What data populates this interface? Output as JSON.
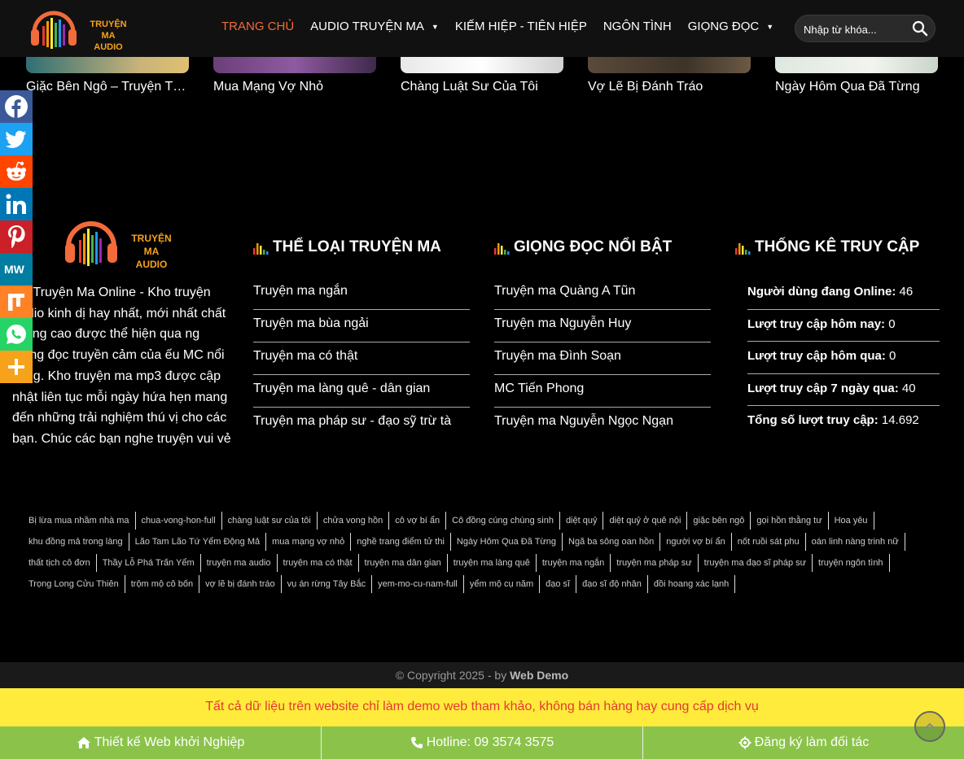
{
  "header": {
    "logo_text_1": "TRUYỆN MA",
    "logo_text_2": "AUDIO",
    "nav": [
      {
        "label": "TRANG CHỦ",
        "active": true,
        "has_caret": false
      },
      {
        "label": "AUDIO TRUYỆN MA",
        "active": false,
        "has_caret": true
      },
      {
        "label": "KIẾM HIỆP - TIÊN HIỆP",
        "active": false,
        "has_caret": false
      },
      {
        "label": "NGÔN TÌNH",
        "active": false,
        "has_caret": false
      },
      {
        "label": "GIỌNG ĐỌC",
        "active": false,
        "has_caret": true
      }
    ],
    "search_placeholder": "Nhập từ khóa..."
  },
  "stories": [
    {
      "title": "Giặc Bên Ngô – Truyện Tâm Linh"
    },
    {
      "title": "Mua Mạng Vợ Nhỏ"
    },
    {
      "title": "Chàng Luật Sư Của Tôi"
    },
    {
      "title": "Vợ Lẽ Bị Đánh Tráo"
    },
    {
      "title": "Ngày Hôm Qua Đã Từng"
    }
  ],
  "footer": {
    "logo_text_1": "TRUYỆN MA",
    "logo_text_2": "AUDIO",
    "about": "dio Truyện Ma Online - Kho truyện audio kinh dị hay nhất, mới nhất chất lượng cao được thể hiện qua ng giọng đọc truyền cảm của ếu MC nổi tiếng. Kho truyện ma mp3 được cập nhật liên tục mỗi ngày hứa hẹn mang đến những trải nghiệm thú vị cho các bạn. Chúc các bạn nghe truyện vui vẻ",
    "genres_title": "THỂ LOẠI TRUYỆN MA",
    "genres": [
      "Truyện ma ngắn",
      "Truyện ma bùa ngải",
      "Truyện ma có thật",
      "Truyện ma làng quê - dân gian",
      "Truyện ma pháp sư - đạo sỹ trừ tà"
    ],
    "voices_title": "GIỌNG ĐỌC NỔI BẬT",
    "voices": [
      "Truyện ma Quàng A Tũn",
      "Truyện ma Nguyễn Huy",
      "Truyện ma Đình Soạn",
      "MC Tiến Phong",
      "Truyện ma Nguyễn Ngọc Ngạn"
    ],
    "stats_title": "THỐNG KÊ TRUY CẬP",
    "stats": [
      {
        "label": "Người dùng đang Online:",
        "value": "46"
      },
      {
        "label": "Lượt truy cập hôm nay:",
        "value": "0"
      },
      {
        "label": "Lượt truy cập hôm qua:",
        "value": "0"
      },
      {
        "label": "Lượt truy cập 7 ngày qua:",
        "value": "40"
      },
      {
        "label": "Tổng số lượt truy cập:",
        "value": "14.692"
      }
    ],
    "tags": [
      "Bị lừa mua nhầm nhà ma",
      "chua-vong-hon-full",
      "chàng luật sư của tôi",
      "chửa vong hồn",
      "cô vợ bí ẩn",
      "Cô đồng cúng chúng sinh",
      "diệt quỷ",
      "diệt quỷ ở quê nội",
      "giặc bên ngô",
      "gọi hồn thằng tư",
      "Hoa yêu",
      "khu đồng mả trong làng",
      "Lão Tam Lão Tứ Yểm Động Mả",
      "mua mạng vợ nhỏ",
      "nghề trang điểm tử thi",
      "Ngày Hôm Qua Đã Từng",
      "Ngã ba sông oan hồn",
      "người vợ bí ẩn",
      "nốt ruồi sát phu",
      "oán linh nàng trinh nữ",
      "thất tịch cô đơn",
      "Thầy Lỗ Phá Trấn Yểm",
      "truyện ma audio",
      "truyện ma có thật",
      "truyện ma dân gian",
      "truyện ma làng quê",
      "truyện ma ngắn",
      "truyện ma pháp sư",
      "truyện ma đạo sĩ pháp sư",
      "truyện ngôn tình",
      "Trọng Long Cửu Thiên",
      "trộm mộ cô bốn",
      "vợ lẽ bị đánh tráo",
      "vụ án rừng Tây Bắc",
      "yem-mo-cu-nam-full",
      "yểm mộ cụ năm",
      "đạo sĩ",
      "đạo sĩ độ nhân",
      "đồi hoang xác lạnh"
    ],
    "copyright_prefix": "© Copyright 2025 - by",
    "copyright_brand": "Web Demo",
    "notice": "Tất cả dữ liệu trên website chỉ làm demo web tham khảo, không bán hàng hay cung cấp dịch vụ"
  },
  "bottom_bar": [
    {
      "label": "Thiết kế Web khởi Nghiệp",
      "icon": "home-icon"
    },
    {
      "label": "Hotline: 09 3574 3575",
      "icon": "phone-icon"
    },
    {
      "label": "Đăng ký làm đối tác",
      "icon": "gear-icon"
    }
  ],
  "share": [
    {
      "name": "facebook-icon",
      "color": "#3b5998"
    },
    {
      "name": "twitter-icon",
      "color": "#1da1f2"
    },
    {
      "name": "reddit-icon",
      "color": "#ff4500"
    },
    {
      "name": "linkedin-icon",
      "color": "#0077b5"
    },
    {
      "name": "pinterest-icon",
      "color": "#cb2027"
    },
    {
      "name": "mewe-icon",
      "color": "#007da1"
    },
    {
      "name": "mix-icon",
      "color": "#ff8226"
    },
    {
      "name": "whatsapp-icon",
      "color": "#25d366"
    },
    {
      "name": "more-icon",
      "color": "#f6a21b"
    }
  ],
  "colors": {
    "accent": "#f26b3a",
    "notice_bg": "#ffeb3b",
    "notice_text": "#e53935",
    "bottom_bar": "#8bc34a"
  }
}
